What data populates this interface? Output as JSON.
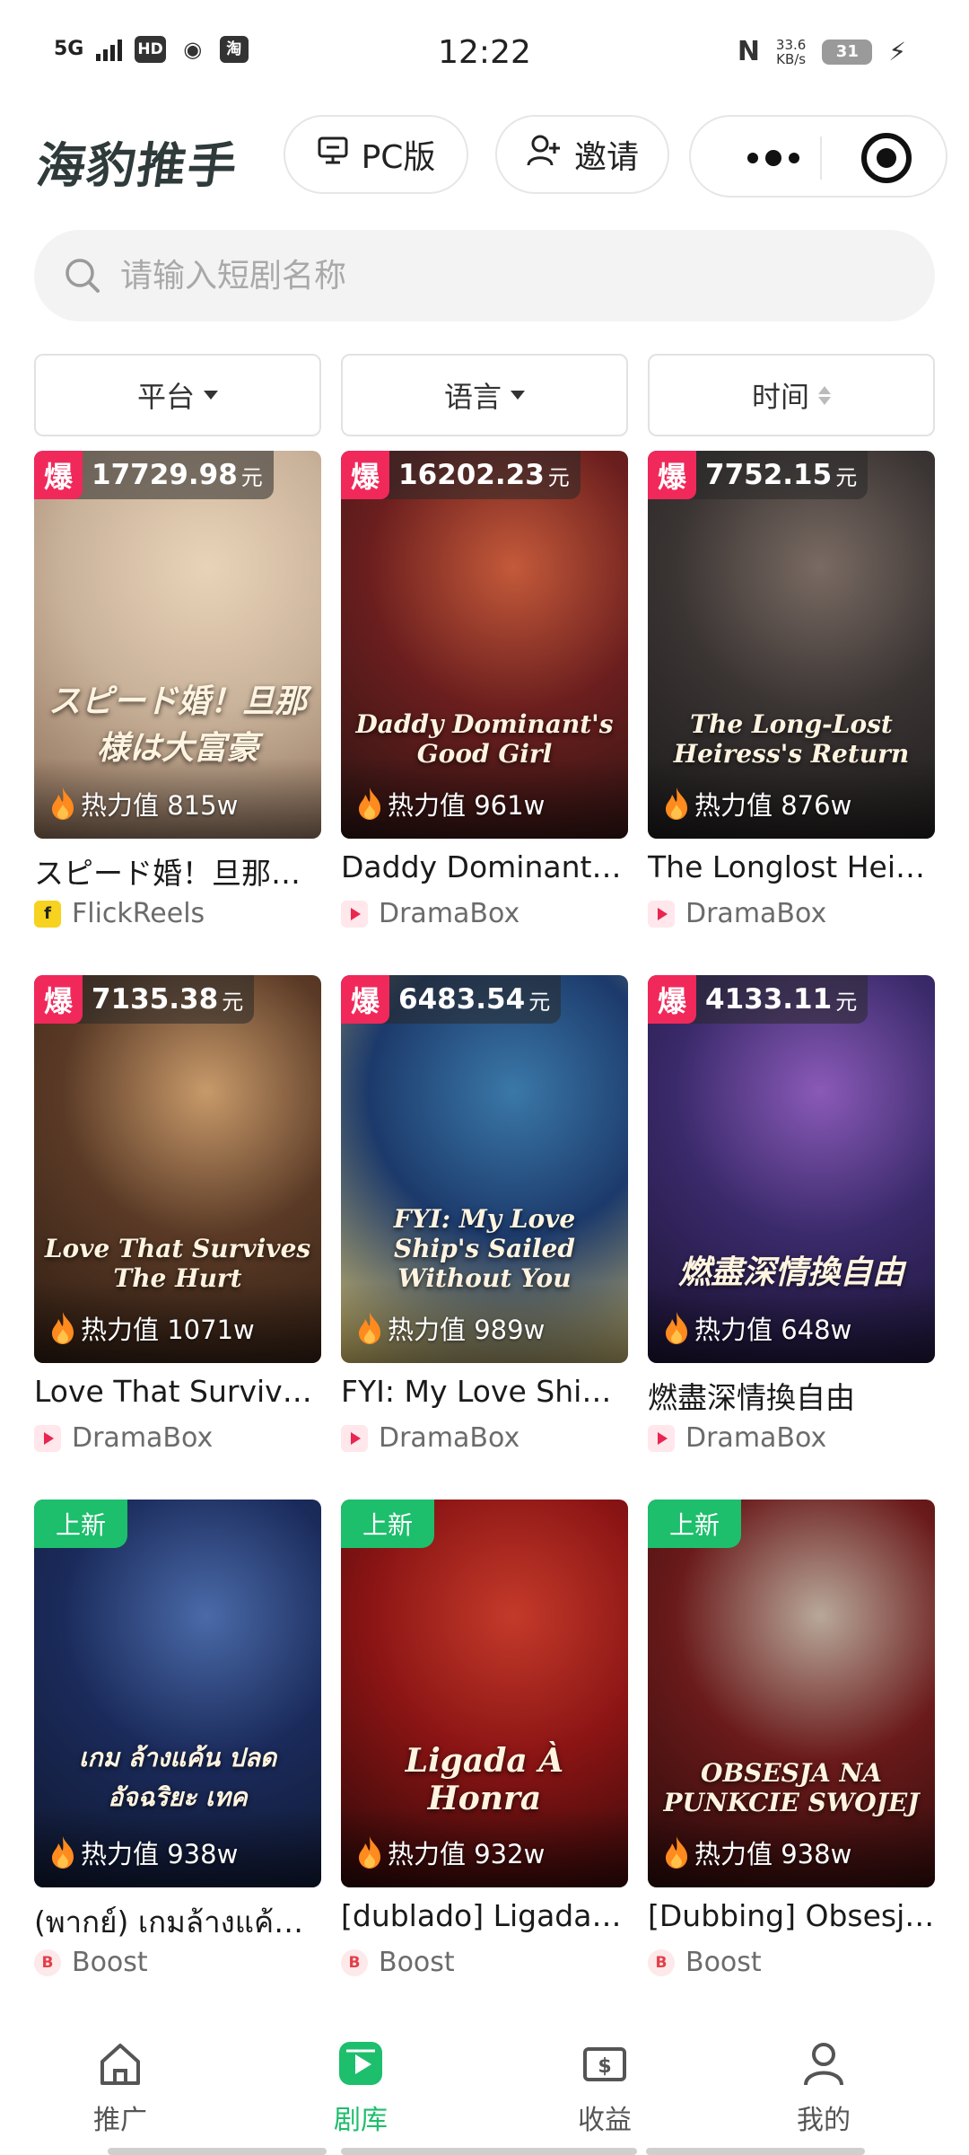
{
  "status_bar": {
    "network": "5G",
    "icon_hd": "HD",
    "icon_taobao": "淘",
    "time": "12:22",
    "nfc": "N",
    "speed_value": "33.6",
    "speed_unit": "KB/s",
    "battery": "31"
  },
  "header": {
    "logo": "海豹推手",
    "pc_button": "PC版",
    "invite_button": "邀请"
  },
  "search": {
    "placeholder": "请输入短剧名称"
  },
  "filters": {
    "platform": "平台",
    "language": "语言",
    "time": "时间"
  },
  "cards": [
    {
      "badge_type": "hot",
      "badge_label": "爆",
      "amount": "17729.98",
      "unit": "元",
      "heat": "热力值 815w",
      "title": "スピード婚！旦那様は大富豪",
      "platform": "FlickReels",
      "platform_icon": "flickreels-icon",
      "poster_text": "スピード婚！旦那様は大富豪",
      "colors": [
        "#c9b29a",
        "#e9d3b8",
        "#8a6b55"
      ]
    },
    {
      "badge_type": "hot",
      "badge_label": "爆",
      "amount": "16202.23",
      "unit": "元",
      "heat": "热力值 961w",
      "title": "Daddy Dominant's Good Girl",
      "platform": "DramaBox",
      "platform_icon": "dramabox-icon",
      "poster_text": "Daddy Dominant's Good Girl",
      "colors": [
        "#6b1e1e",
        "#c45a3a",
        "#2a1412"
      ]
    },
    {
      "badge_type": "hot",
      "badge_label": "爆",
      "amount": "7752.15",
      "unit": "元",
      "heat": "热力值 876w",
      "title": "The Longlost Heiress's Return",
      "platform": "DramaBox",
      "platform_icon": "dramabox-icon",
      "poster_text": "The Long-Lost Heiress's Return",
      "colors": [
        "#3a3433",
        "#7a6b63",
        "#1c1a1a"
      ]
    },
    {
      "badge_type": "hot",
      "badge_label": "爆",
      "amount": "7135.38",
      "unit": "元",
      "heat": "热力值 1071w",
      "title": "Love That Survives the Hurt",
      "platform": "DramaBox",
      "platform_icon": "dramabox-icon",
      "poster_text": "Love That Survives The Hurt",
      "colors": [
        "#5a3a26",
        "#c89a6a",
        "#2e1c12"
      ]
    },
    {
      "badge_type": "hot",
      "badge_label": "爆",
      "amount": "6483.54",
      "unit": "元",
      "heat": "热力值 989w",
      "title": "FYI: My Love Ship's Sailed Without You",
      "platform": "DramaBox",
      "platform_icon": "dramabox-icon",
      "poster_text": "FYI: My Love Ship's Sailed Without You",
      "colors": [
        "#1c3a6b",
        "#3a78a8",
        "#d9c06a"
      ]
    },
    {
      "badge_type": "hot",
      "badge_label": "爆",
      "amount": "4133.11",
      "unit": "元",
      "heat": "热力值 648w",
      "title": "燃盡深情換自由",
      "platform": "DramaBox",
      "platform_icon": "dramabox-icon",
      "poster_text": "燃盡深情換自由",
      "colors": [
        "#3a2a6b",
        "#8a5ab8",
        "#1a1230"
      ]
    },
    {
      "badge_type": "new",
      "badge_label": "上新",
      "amount": "",
      "unit": "",
      "heat": "热力值 938w",
      "title": "(พากย์) เกมล้างแค้น ปลดอัจฉริยะ เทค",
      "platform": "Boost",
      "platform_icon": "boost-icon",
      "poster_text": "เกม ล้างแค้น ปลด อัจฉริยะ เทค",
      "colors": [
        "#1a2a5a",
        "#4a6aa8",
        "#101830"
      ]
    },
    {
      "badge_type": "new",
      "badge_label": "上新",
      "amount": "",
      "unit": "",
      "heat": "热力值 932w",
      "title": "[dublado] Ligada À Honra",
      "platform": "Boost",
      "platform_icon": "boost-icon",
      "poster_text": "Ligada À Honra",
      "colors": [
        "#8a1414",
        "#c43a2a",
        "#2a0808"
      ]
    },
    {
      "badge_type": "new",
      "badge_label": "上新",
      "amount": "",
      "unit": "",
      "heat": "热力值 938w",
      "title": "[Dubbing] Obsesja na punkcie swojej",
      "platform": "Boost",
      "platform_icon": "boost-icon",
      "poster_text": "OBSESJA NA PUNKCIE SWOJEJ",
      "colors": [
        "#6a1a1a",
        "#b8a89a",
        "#2a0a0a"
      ]
    }
  ],
  "bottom_nav": [
    {
      "label": "推广",
      "icon": "home-icon",
      "active": false
    },
    {
      "label": "剧库",
      "icon": "film-icon",
      "active": true
    },
    {
      "label": "收益",
      "icon": "wallet-icon",
      "active": false
    },
    {
      "label": "我的",
      "icon": "person-icon",
      "active": false
    }
  ],
  "colors": {
    "accent": "#1dbe6c",
    "hot_badge": "#f0295a",
    "heat_flame": "#ff8a1e"
  }
}
